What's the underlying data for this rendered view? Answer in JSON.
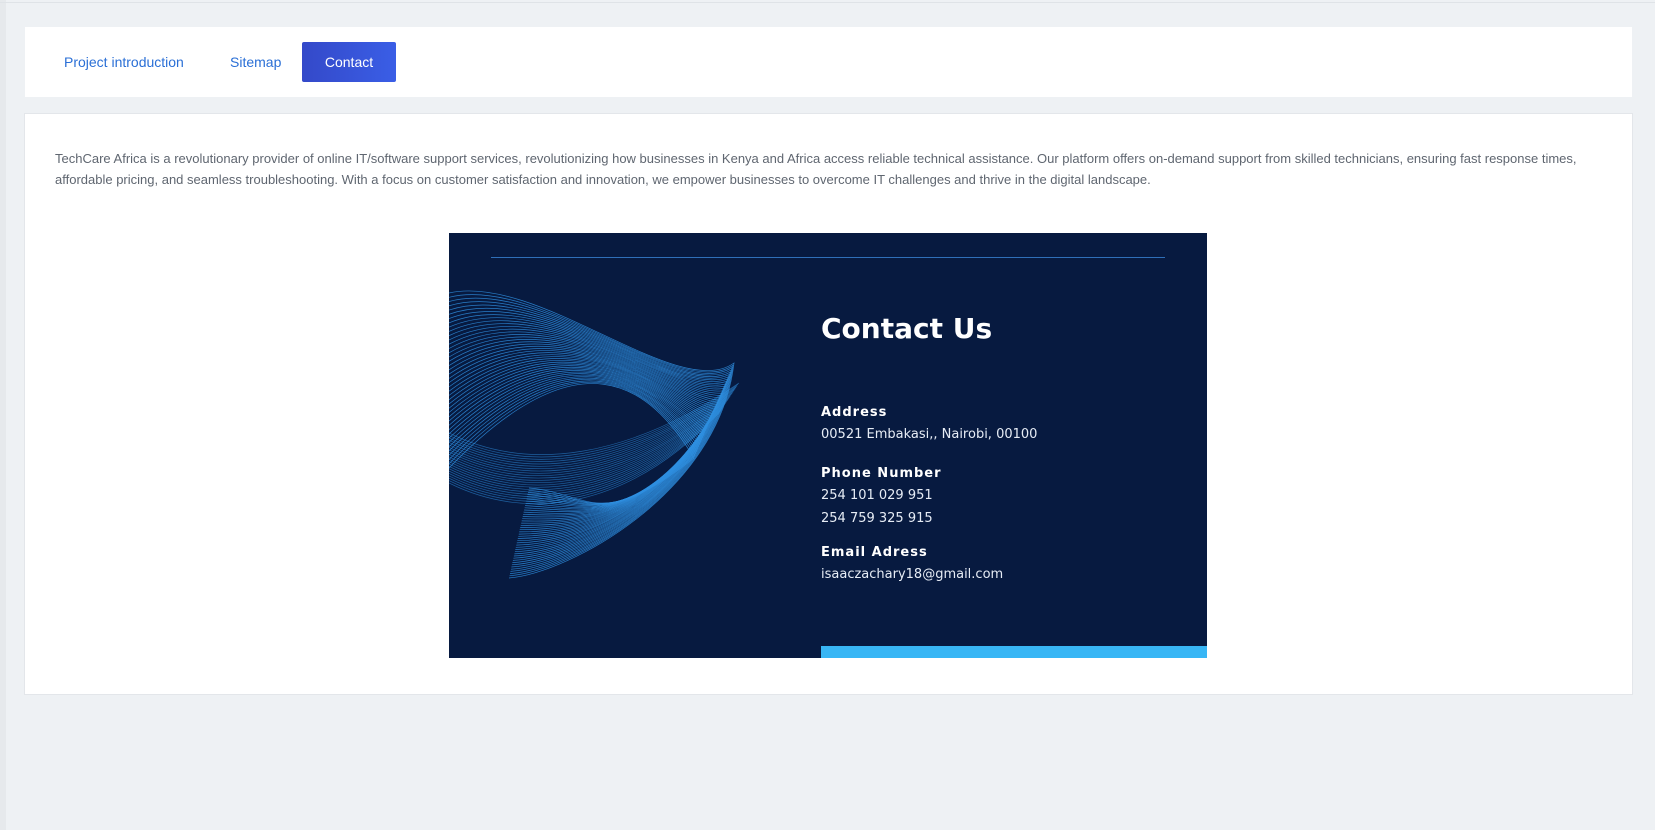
{
  "tabs": [
    {
      "label": "Project introduction",
      "active": false
    },
    {
      "label": "Sitemap",
      "active": false
    },
    {
      "label": "Contact",
      "active": true
    }
  ],
  "content": {
    "description": "TechCare Africa is a revolutionary provider of online IT/software support services, revolutionizing how businesses in Kenya and Africa access reliable technical assistance. Our platform offers on-demand support from skilled technicians, ensuring fast response times, affordable pricing, and seamless troubleshooting. With a focus on customer satisfaction and innovation, we empower businesses to overcome IT challenges and thrive in the digital landscape."
  },
  "contact_card": {
    "title": "Contact Us",
    "address_label": "Address",
    "address_value": "00521 Embakasi,, Nairobi, 00100",
    "phone_label": "Phone Number",
    "phone_1": "254 101 029 951",
    "phone_2": "254 759 325 915",
    "email_label": "Email Adress",
    "email_value": "isaaczachary18@gmail.com"
  },
  "colors": {
    "page_background": "#eef1f4",
    "active_tab": "#3a5ee6",
    "link": "#2a6fd6",
    "card_background": "#071a40",
    "wave_lines": "#2f8fe0",
    "accent_bar": "#38b6f5"
  }
}
